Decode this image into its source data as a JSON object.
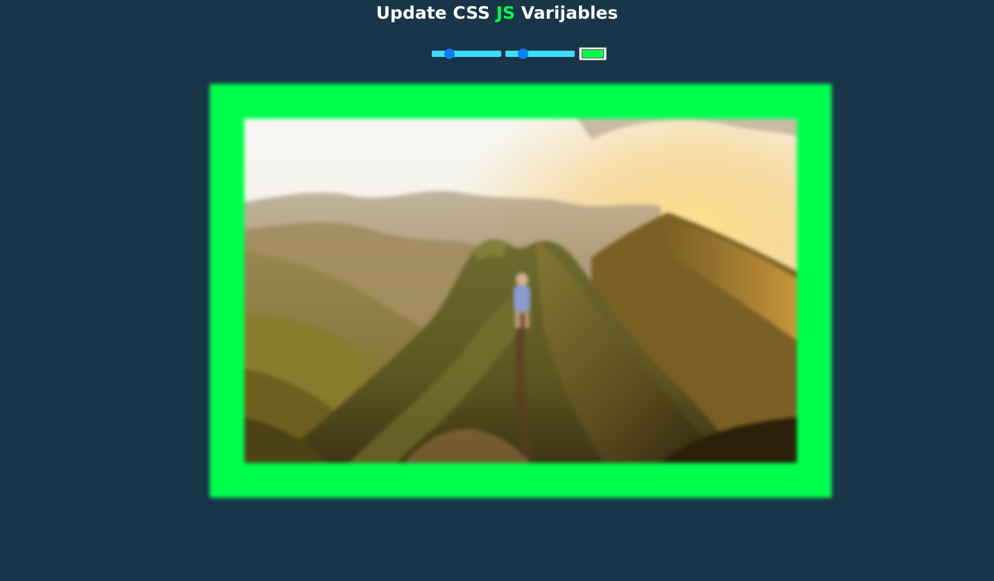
{
  "header": {
    "title_part1": "Update CSS ",
    "title_highlight": "JS",
    "title_part2": " Varijables",
    "highlight_color": "#00ff4c"
  },
  "controls": {
    "spacing_slider": {
      "value": 0.25
    },
    "blur_slider": {
      "value": 0.25
    },
    "base_color": "#00ff4c"
  },
  "image": {
    "subject": "person-hiking-on-mountain-ridge-at-sunset"
  }
}
